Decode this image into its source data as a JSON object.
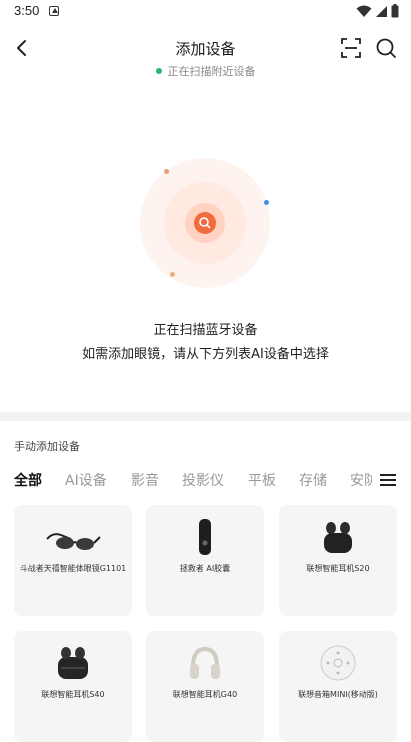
{
  "status_bar": {
    "time": "3:50"
  },
  "header": {
    "title": "添加设备",
    "scan_status": "正在扫描附近设备"
  },
  "scan": {
    "text": "正在扫描蓝牙设备",
    "hint": "如需添加眼镜，请从下方列表AI设备中选择"
  },
  "manual": {
    "title": "手动添加设备",
    "tabs": [
      "全部",
      "AI设备",
      "影音",
      "投影仪",
      "平板",
      "存储",
      "安防"
    ]
  },
  "devices": [
    {
      "name": "斗战者天禧智能体眼镜G1101",
      "icon": "glasses-icon"
    },
    {
      "name": "拯救者 AI胶囊",
      "icon": "capsule-icon"
    },
    {
      "name": "联想智能耳机S20",
      "icon": "earbuds-icon"
    },
    {
      "name": "联想智能耳机S40",
      "icon": "earbuds-icon"
    },
    {
      "name": "联想智能耳机G40",
      "icon": "headphones-icon"
    },
    {
      "name": "联想音箱MINI(移动版)",
      "icon": "speaker-icon"
    }
  ],
  "colors": {
    "accent": "#f26b3d",
    "scan_dot": "#2bb673"
  }
}
